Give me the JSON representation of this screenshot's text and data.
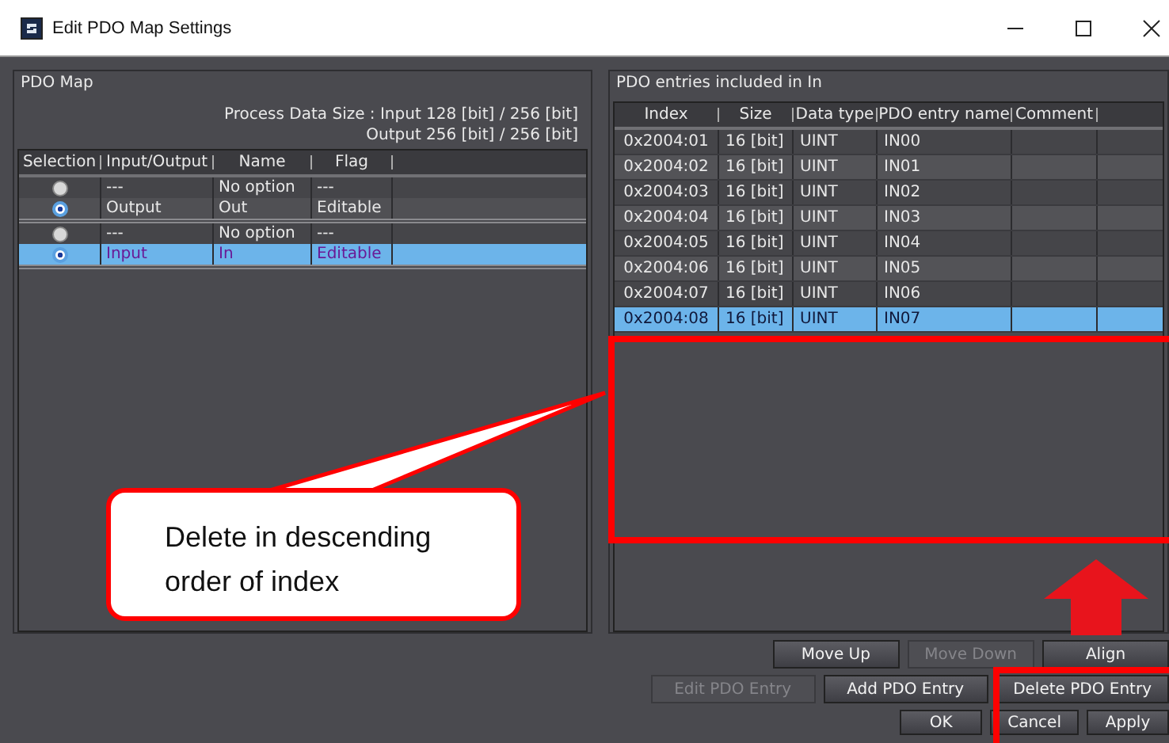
{
  "window": {
    "title": "Edit PDO Map Settings"
  },
  "pdo_map": {
    "heading": "PDO Map",
    "size_lines": [
      "Process Data Size : Input  128 [bit]  /  256 [bit]",
      "Output  256 [bit]  /  256 [bit]"
    ],
    "columns": [
      "Selection",
      "Input/Output",
      "Name",
      "Flag"
    ],
    "groups": [
      {
        "rows": [
          {
            "checked": false,
            "selected": false,
            "io": "---",
            "name": "No option",
            "flag": "---"
          },
          {
            "checked": true,
            "selected": false,
            "io": "Output",
            "name": "Out",
            "flag": "Editable"
          }
        ]
      },
      {
        "rows": [
          {
            "checked": false,
            "selected": false,
            "io": "---",
            "name": "No option",
            "flag": "---"
          },
          {
            "checked": true,
            "selected": true,
            "io": "Input",
            "name": "In",
            "flag": "Editable"
          }
        ]
      }
    ]
  },
  "entries": {
    "heading": "PDO entries included in In",
    "columns": [
      "Index",
      "Size",
      "Data type",
      "PDO entry name",
      "Comment"
    ],
    "rows": [
      {
        "index": "0x2004:01",
        "size": "16 [bit]",
        "type": "UINT",
        "name": "IN00",
        "selected": false
      },
      {
        "index": "0x2004:02",
        "size": "16 [bit]",
        "type": "UINT",
        "name": "IN01",
        "selected": false
      },
      {
        "index": "0x2004:03",
        "size": "16 [bit]",
        "type": "UINT",
        "name": "IN02",
        "selected": false
      },
      {
        "index": "0x2004:04",
        "size": "16 [bit]",
        "type": "UINT",
        "name": "IN03",
        "selected": false
      },
      {
        "index": "0x2004:05",
        "size": "16 [bit]",
        "type": "UINT",
        "name": "IN04",
        "selected": false
      },
      {
        "index": "0x2004:06",
        "size": "16 [bit]",
        "type": "UINT",
        "name": "IN05",
        "selected": false
      },
      {
        "index": "0x2004:07",
        "size": "16 [bit]",
        "type": "UINT",
        "name": "IN06",
        "selected": false
      },
      {
        "index": "0x2004:08",
        "size": "16 [bit]",
        "type": "UINT",
        "name": "IN07",
        "selected": true
      }
    ]
  },
  "button_rows": [
    [
      {
        "label": "Move Up",
        "disabled": false
      },
      {
        "label": "Move Down",
        "disabled": true
      },
      {
        "label": "Align",
        "disabled": false
      }
    ],
    [
      {
        "label": "Edit PDO Entry",
        "disabled": true
      },
      {
        "label": "Add PDO Entry",
        "disabled": false
      },
      {
        "label": "Delete PDO Entry",
        "disabled": false
      }
    ],
    [
      {
        "label": "OK",
        "disabled": false
      },
      {
        "label": "Cancel",
        "disabled": false
      },
      {
        "label": "Apply",
        "disabled": false
      }
    ]
  ],
  "annotation": {
    "text": "Delete in descending order of index"
  }
}
